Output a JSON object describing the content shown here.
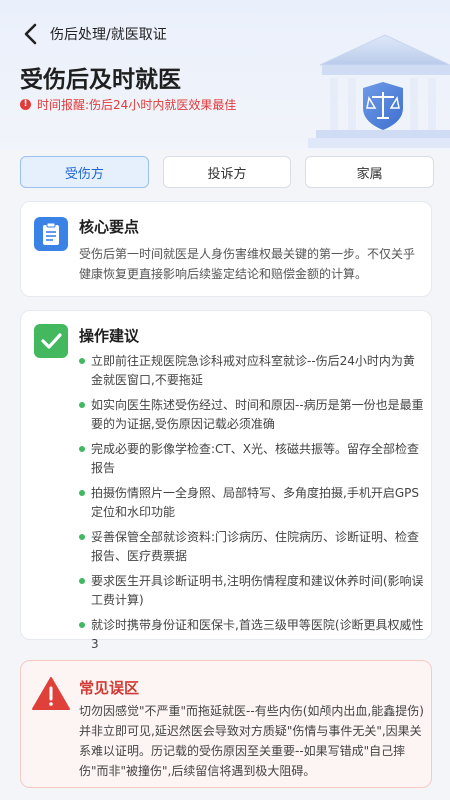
{
  "nav": {
    "back_icon": "chevron-left-icon",
    "breadcrumb": "伤后处理/就医取证"
  },
  "header": {
    "title": "受伤后及时就医",
    "alert_icon": "alert-circle-icon",
    "alert_text": "时间报醒:伤后24小时内就医效果最佳",
    "illustration": "courthouse-scales-icon"
  },
  "tabs": [
    {
      "label": "受伤方",
      "active": true
    },
    {
      "label": "投诉方",
      "active": false
    },
    {
      "label": "家属",
      "active": false
    }
  ],
  "core": {
    "icon": "clipboard-icon",
    "title": "核心要点",
    "body": "受伤后第一时间就医是人身伤害维权最关键的第一步。不仅关乎健康恢复更直接影响后续鉴定结论和赔偿金额的计算。"
  },
  "advice": {
    "icon": "checkmark-icon",
    "title": "操作建议",
    "items": [
      "立即前往正规医院急诊科戒对应科室就诊--伤后24小时内为黄金就医窗口,不要拖延",
      "如实向医生陈述受伤经过、时间和原因--病历是第一份也是最重要的为证据,受伤原因记载必须准确",
      "完成必要的影像学检查:CT、X光、核磁共振等。留存全部检查报告",
      "拍摄伤情照片一全身照、局部特写、多角度拍摄,手机开启GPS定位和水印功能",
      "妥善保管全部就诊资料:门诊病历、住院病历、诊断证明、检查报告、医疗费票据",
      "要求医生开具诊断证明书,注明伤情程度和建议休养时间(影响误工费计算)",
      "就诊时携带身份证和医保卡,首选三级甲等医院(诊断更具权威性3"
    ]
  },
  "pitfalls": {
    "icon": "warning-triangle-icon",
    "title": "常见误区",
    "body": "切勿因感觉\"不严重\"而拖延就医--有些内伤(如颅内出血,能鑫提伤)并非立即可见,延迟然医会导致对方质疑\"伤情与事件无关\",因果关系难以证明。历记载的受伤原因至关重要--如果写错成\"自己摔伤\"而非\"被撞伤\",后续留信将遇到极大阻碍。"
  },
  "colors": {
    "accent_blue": "#3b82e6",
    "success_green": "#43b85f",
    "danger_red": "#e23b3b"
  }
}
